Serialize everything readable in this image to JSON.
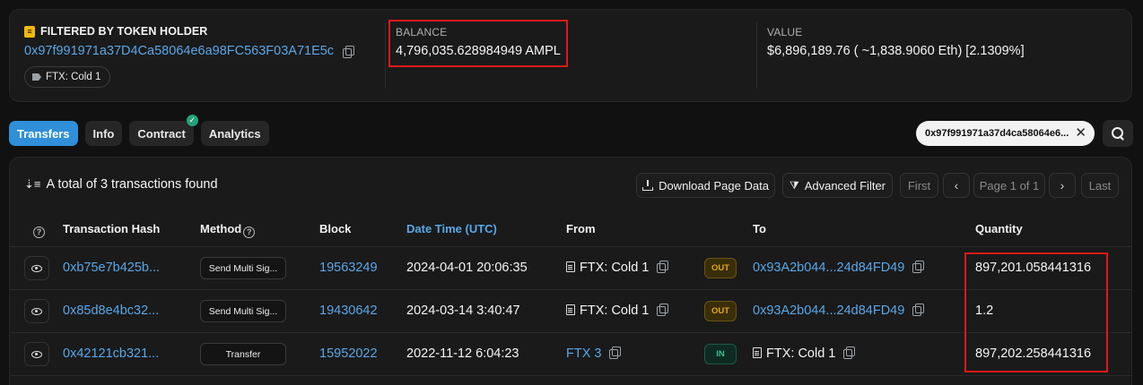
{
  "holder": {
    "heading": "FILTERED BY TOKEN HOLDER",
    "address": "0x97f991971a37D4Ca58064e6a98FC563F03A71E5c",
    "tag": "FTX: Cold 1"
  },
  "balance": {
    "label": "BALANCE",
    "value": "4,796,035.628984949 AMPL"
  },
  "value": {
    "label": "VALUE",
    "value": "$6,896,189.76 ( ~1,838.9060 Eth) [2.1309%]"
  },
  "tabs": [
    {
      "label": "Transfers"
    },
    {
      "label": "Info"
    },
    {
      "label": "Contract"
    },
    {
      "label": "Analytics"
    }
  ],
  "filter_chip": "0x97f991971a37d4ca58064e6...",
  "summary": "A total of 3 transactions found",
  "toolbar": {
    "download": "Download Page Data",
    "advanced": "Advanced Filter",
    "first": "First",
    "page": "Page 1 of 1",
    "last": "Last"
  },
  "columns": {
    "hash": "Transaction Hash",
    "method": "Method",
    "block": "Block",
    "datetime": "Date Time (UTC)",
    "from": "From",
    "to": "To",
    "quantity": "Quantity"
  },
  "rows": [
    {
      "hash": "0xb75e7b425b...",
      "method": "Send Multi Sig...",
      "block": "19563249",
      "datetime": "2024-04-01 20:06:35",
      "from": "FTX: Cold 1",
      "direction": "OUT",
      "to": "0x93A2b044...24d84FD49",
      "quantity": "897,201.058441316"
    },
    {
      "hash": "0x85d8e4bc32...",
      "method": "Send Multi Sig...",
      "block": "19430642",
      "datetime": "2024-03-14 3:40:47",
      "from": "FTX: Cold 1",
      "direction": "OUT",
      "to": "0x93A2b044...24d84FD49",
      "quantity": "1.2"
    },
    {
      "hash": "0x42121cb321...",
      "method": "Transfer",
      "block": "15952022",
      "datetime": "2022-11-12 6:04:23",
      "from": "FTX 3",
      "direction": "IN",
      "to": "FTX: Cold 1",
      "quantity": "897,202.258441316"
    }
  ]
}
